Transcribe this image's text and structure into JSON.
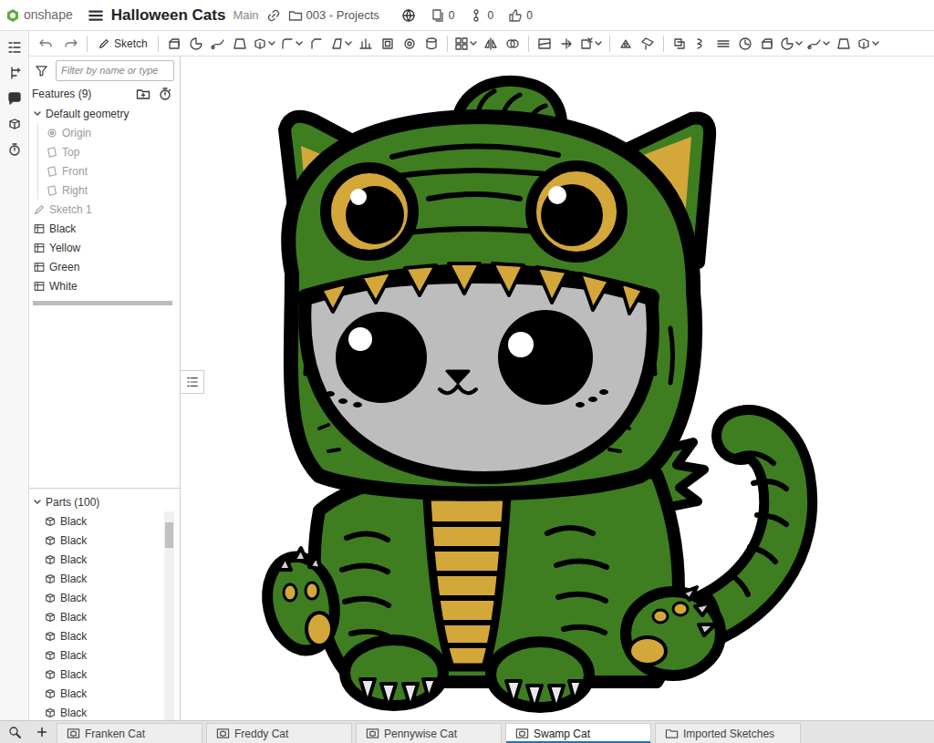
{
  "app": {
    "logo": "onshape"
  },
  "document": {
    "title": "Halloween Cats",
    "branch": "Main",
    "folder": "003 - Projects",
    "badges": [
      {
        "kind": "copies",
        "value": "0"
      },
      {
        "kind": "versions",
        "value": "0"
      },
      {
        "kind": "likes",
        "value": "0"
      }
    ]
  },
  "toolbar": {
    "sketch_button": "Sketch"
  },
  "features": {
    "filter_placeholder": "Filter by name or type",
    "heading": "Features (9)",
    "default_geometry": {
      "label": "Default geometry",
      "expanded": true,
      "items": [
        {
          "label": "Origin",
          "kind": "point",
          "disabled": true
        },
        {
          "label": "Top",
          "kind": "plane",
          "disabled": true
        },
        {
          "label": "Front",
          "kind": "plane",
          "disabled": true
        },
        {
          "label": "Right",
          "kind": "plane",
          "disabled": true
        }
      ]
    },
    "items": [
      {
        "label": "Sketch 1",
        "kind": "sketch",
        "disabled": true
      },
      {
        "label": "Black",
        "kind": "feature",
        "disabled": false
      },
      {
        "label": "Yellow",
        "kind": "feature",
        "disabled": false
      },
      {
        "label": "Green",
        "kind": "feature",
        "disabled": false
      },
      {
        "label": "White",
        "kind": "feature",
        "disabled": false
      }
    ]
  },
  "parts": {
    "heading": "Parts (100)",
    "expanded": true,
    "items": [
      {
        "label": "Black"
      },
      {
        "label": "Black"
      },
      {
        "label": "Black"
      },
      {
        "label": "Black"
      },
      {
        "label": "Black"
      },
      {
        "label": "Black"
      },
      {
        "label": "Black"
      },
      {
        "label": "Black"
      },
      {
        "label": "Black"
      },
      {
        "label": "Black"
      },
      {
        "label": "Black"
      }
    ]
  },
  "tabs": [
    {
      "label": "Franken Cat",
      "kind": "partstudio",
      "selected": false
    },
    {
      "label": "Freddy Cat",
      "kind": "partstudio",
      "selected": false
    },
    {
      "label": "Pennywise Cat",
      "kind": "partstudio",
      "selected": false
    },
    {
      "label": "Swamp Cat",
      "kind": "partstudio",
      "selected": true
    },
    {
      "label": "Imported Sketches",
      "kind": "folder",
      "selected": false
    }
  ]
}
